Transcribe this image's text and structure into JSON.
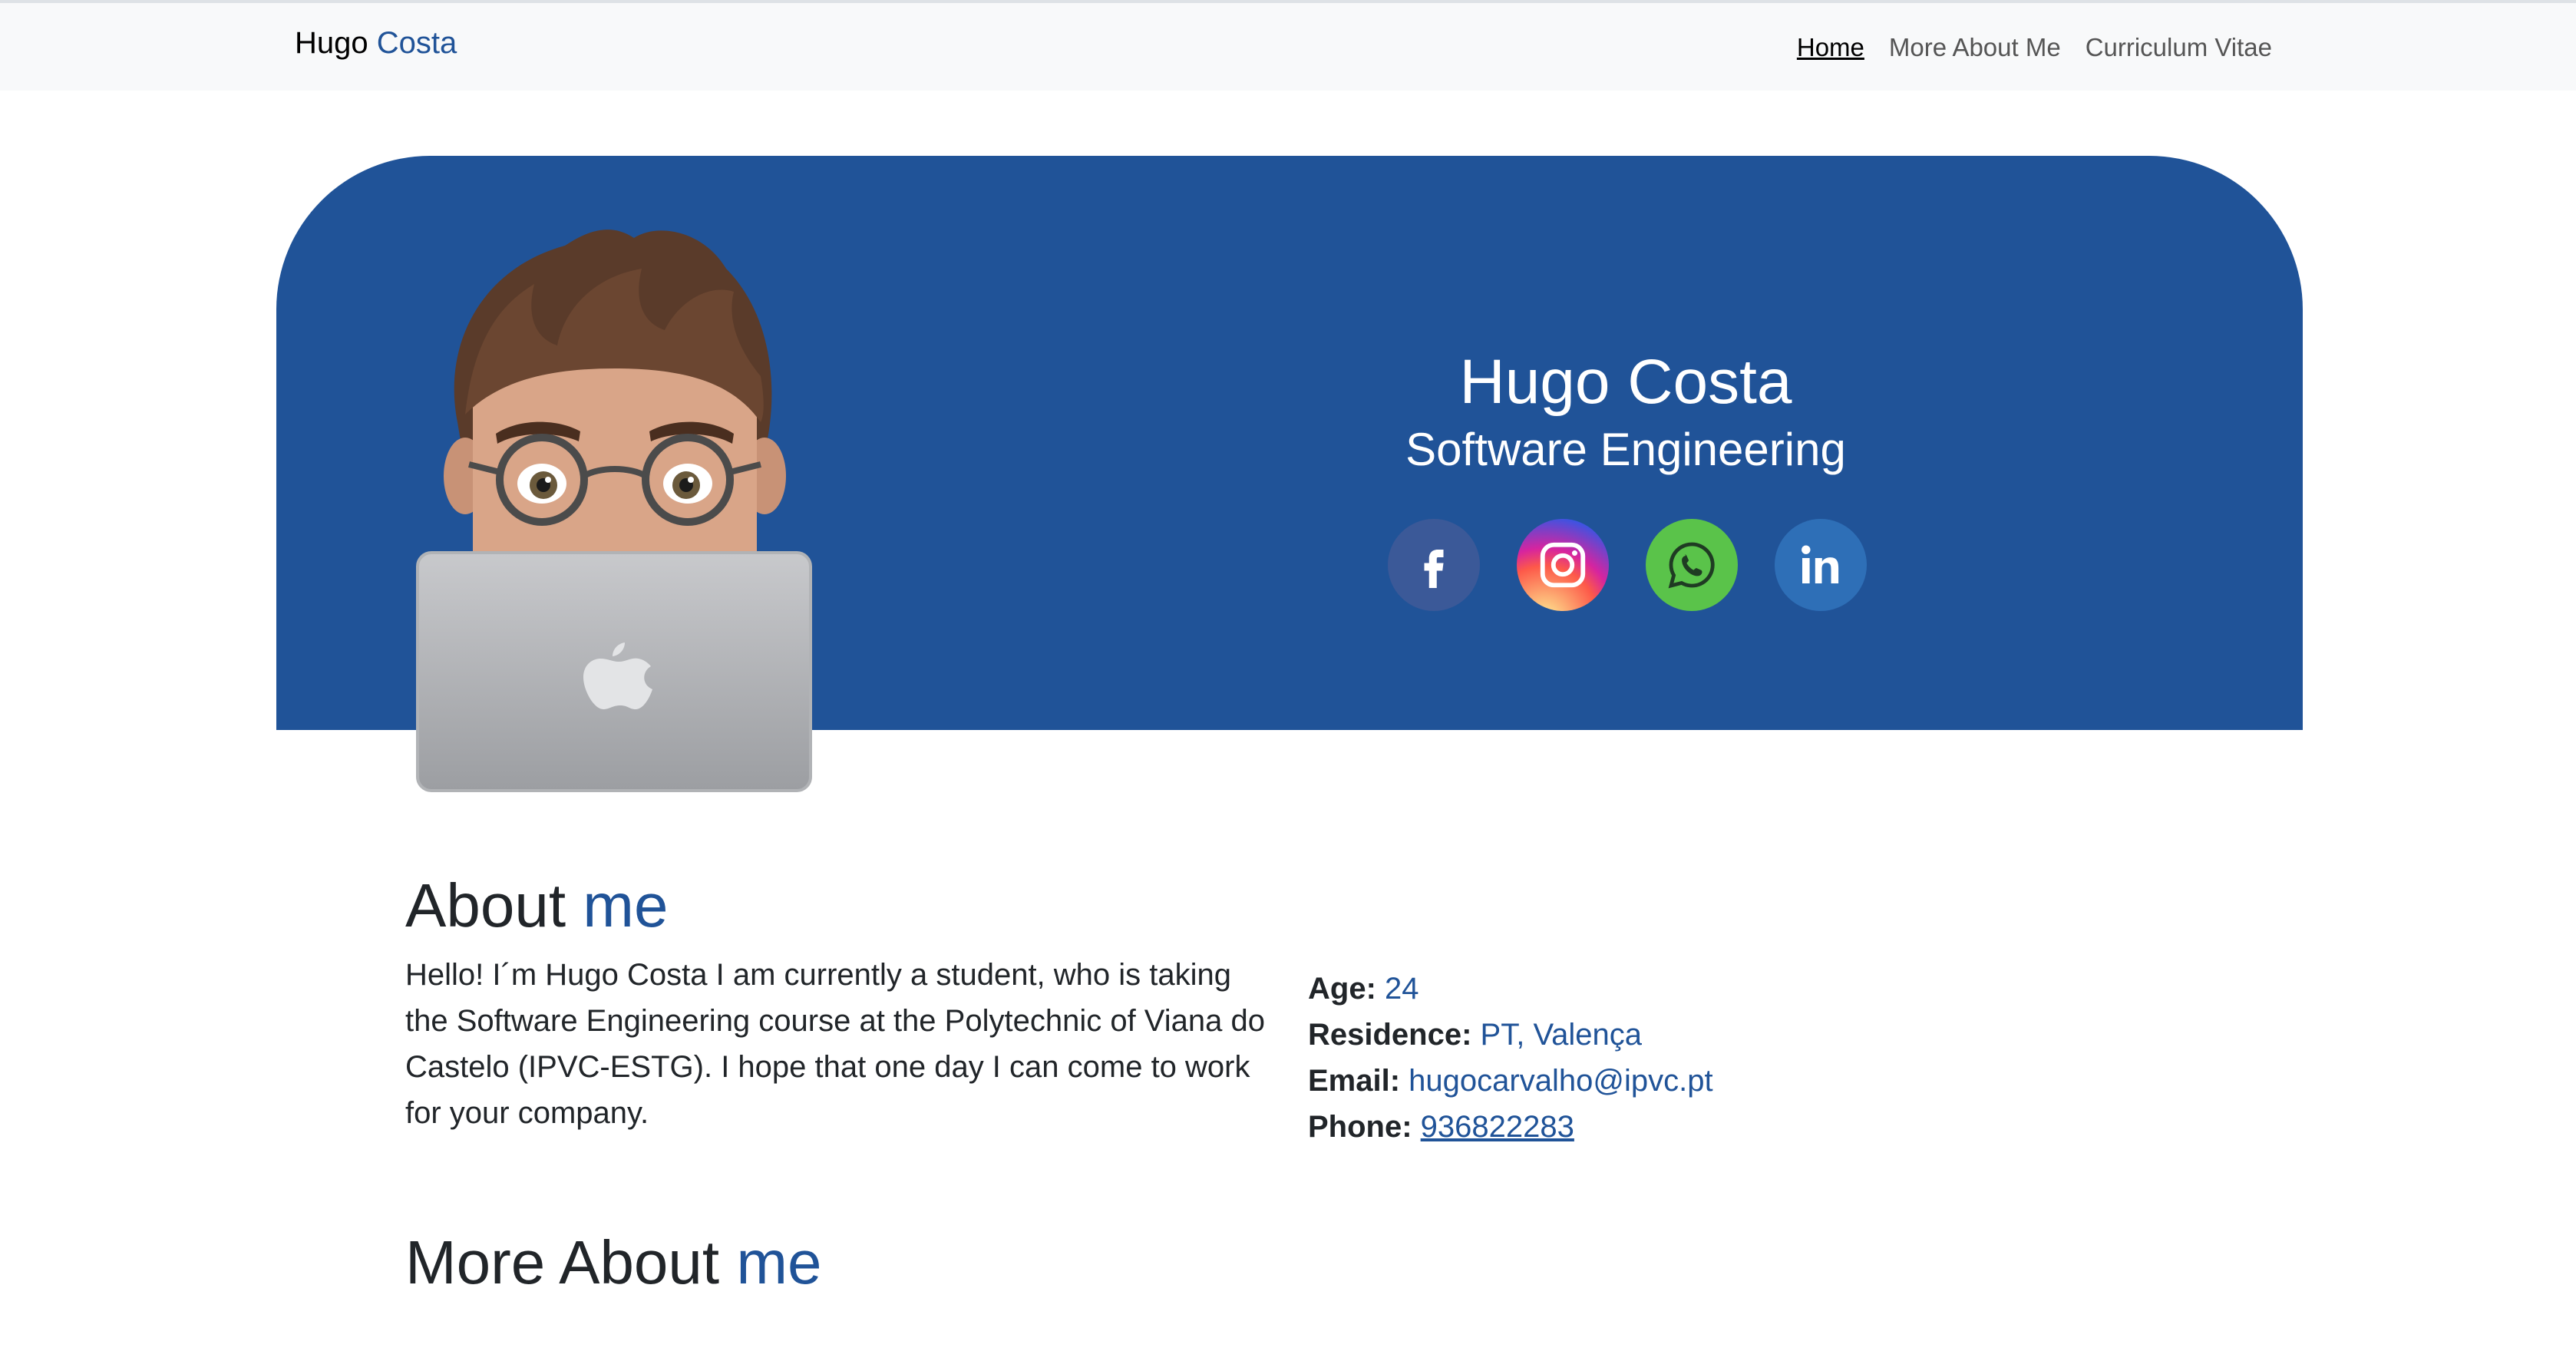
{
  "navbar": {
    "brand_first": "Hugo",
    "brand_second": "Costa",
    "links": [
      {
        "label": "Home",
        "active": true
      },
      {
        "label": "More About Me",
        "active": false
      },
      {
        "label": "Curriculum Vitae",
        "active": false
      }
    ]
  },
  "hero": {
    "name": "Hugo Costa",
    "subtitle": "Software Engineering",
    "socials": [
      {
        "icon": "facebook-icon",
        "color": "#3b5998"
      },
      {
        "icon": "instagram-icon",
        "color": "#d6249f"
      },
      {
        "icon": "whatsapp-icon",
        "color": "#5ac34a"
      },
      {
        "icon": "linkedin-icon",
        "color": "#2e6fb7"
      }
    ],
    "background_color": "#205398"
  },
  "about": {
    "title_first": "About",
    "title_accent": "me",
    "text": "Hello! I´m Hugo Costa I am currently a student, who is taking the Software Engineering course at the Polytechnic of Viana do Castelo (IPVC-ESTG). I hope that one day I can come to work for your company.",
    "info": {
      "age_label": "Age:",
      "age_value": "24",
      "residence_label": "Residence:",
      "residence_value": "PT, Valença",
      "email_label": "Email:",
      "email_value": "hugocarvalho@ipvc.pt",
      "phone_label": "Phone:",
      "phone_value": "936822283"
    }
  },
  "more_about": {
    "title_first": "More About",
    "title_accent": "me"
  },
  "colors": {
    "accent": "#205398",
    "navbar_bg": "#f8f9fa"
  }
}
